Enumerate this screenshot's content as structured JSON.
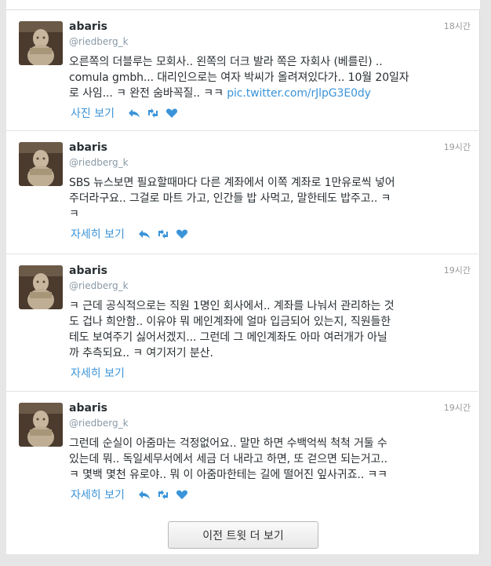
{
  "colors": {
    "link": "#3b94d9",
    "name": "#292f33",
    "muted": "#8899a6"
  },
  "tweets": [
    {
      "name": "abaris",
      "handle": "@riedberg_k",
      "time": "18시간",
      "lines": [
        "오른쪽의 더블루는 모회사.. 왼쪽의 더크 발라 쪽은 자회사 (베를린) ..",
        "comula gmbh... 대리인으로는 여자 박씨가 올려져있다가.. 10월 20일자",
        "로 사임... ㅋ 완전 숨바꼭질.. ㅋㅋ "
      ],
      "link": "pic.twitter.com/rJlpG3E0dy",
      "action_label": "사진 보기",
      "icons": [
        "reply-icon",
        "retweet-icon",
        "favorite-icon"
      ]
    },
    {
      "name": "abaris",
      "handle": "@riedberg_k",
      "time": "19시간",
      "lines": [
        "SBS 뉴스보면 필요할때마다 다른 계좌에서 이쪽 계좌로 1만유로씩 넣어",
        "주더라구요.. 그걸로 마트 가고, 인간들 밥 사먹고, 말한테도 밥주고.. ㅋ",
        "ㅋ"
      ],
      "action_label": "자세히 보기"
    },
    {
      "name": "abaris",
      "handle": "@riedberg_k",
      "time": "19시간",
      "lines": [
        "ㅋ 근데 공식적으로는 직원 1명인 회사에서.. 계좌를 나눠서 관리하는 것",
        "도 겁나 희안함.. 이유야 뭐 메인계좌에 얼마 입금되어 있는지, 직원들한",
        "테도 보여주기 싫어서겠지... 그런데 그 메인계좌도 아마 여러개가 아닐",
        "까 추측되요.. ㅋ 여기저기 분산."
      ],
      "action_label": "자세히 보기"
    },
    {
      "name": "abaris",
      "handle": "@riedberg_k",
      "time": "19시간",
      "lines": [
        "그런데 순실이 아줌마는 걱정없어요.. 말만 하면 수백억씩 척척 거둘 수",
        "있는데 뭐.. 독일세무서에서 세금 더 내라고 하면, 또 걷으면 되는거고..",
        "ㅋ 몇백 몇천 유로야.. 뭐 이 아줌마한테는 길에 떨어진 잎사귀죠.. ㅋㅋ"
      ],
      "action_label": "자세히 보기"
    }
  ],
  "more_button": "이전 트윗 더 보기"
}
